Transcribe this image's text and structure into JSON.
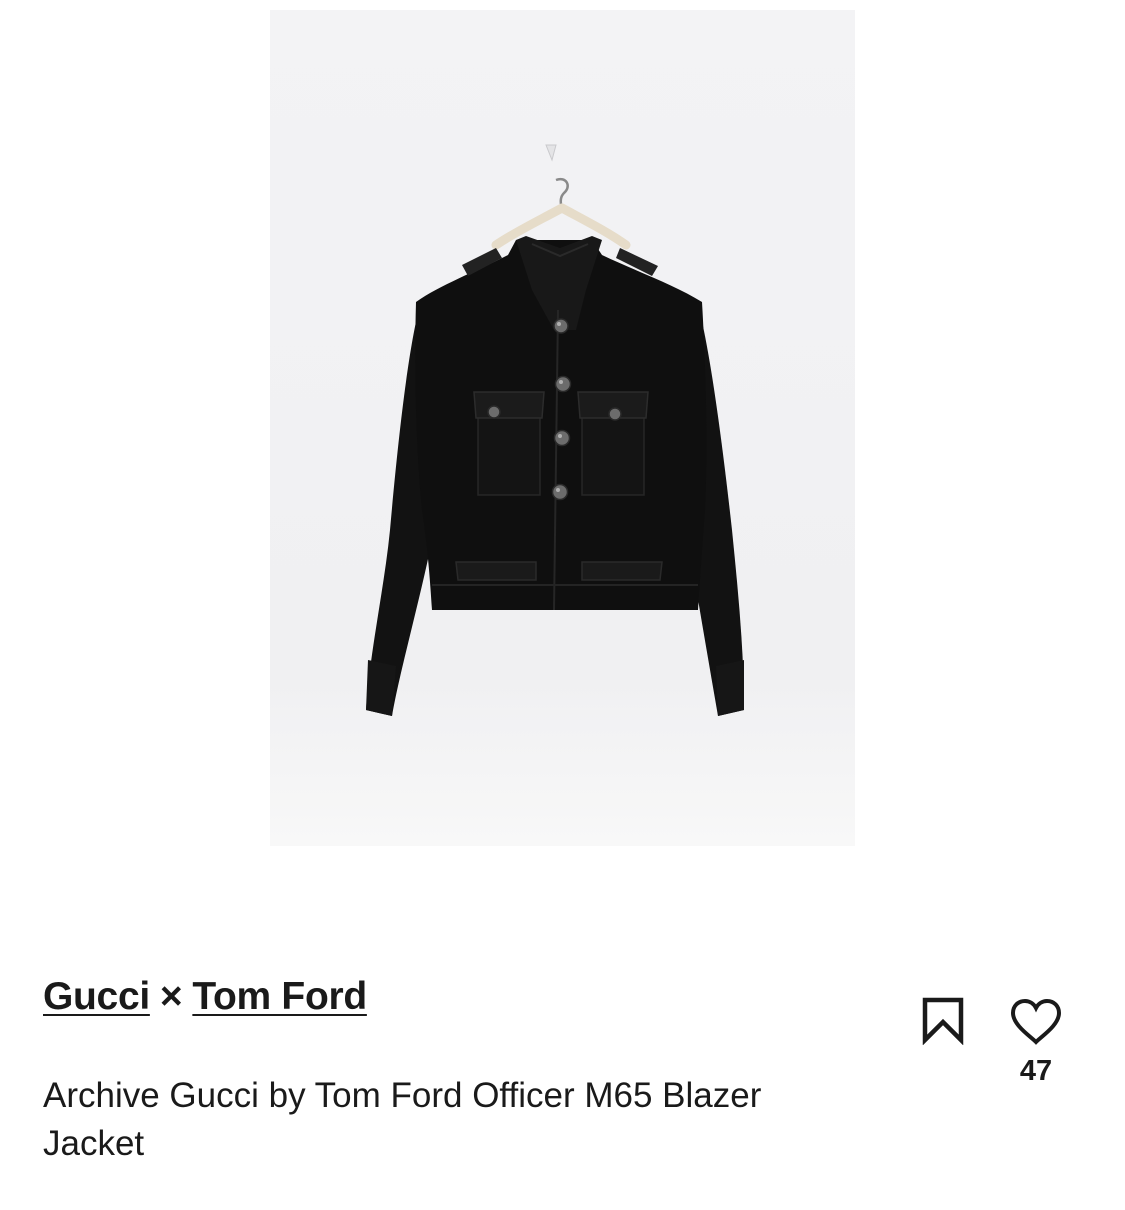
{
  "listing": {
    "designer_1": "Gucci",
    "separator": "×",
    "designer_2": "Tom Ford",
    "title": "Archive Gucci by Tom Ford Officer M65 Blazer Jacket",
    "like_count": "47"
  },
  "icons": {
    "save": "bookmark-icon",
    "like": "heart-icon"
  },
  "colors": {
    "text": "#1a1a1a",
    "background": "#ffffff",
    "photo_backdrop": "#f1f1f3",
    "jacket": "#101010"
  }
}
